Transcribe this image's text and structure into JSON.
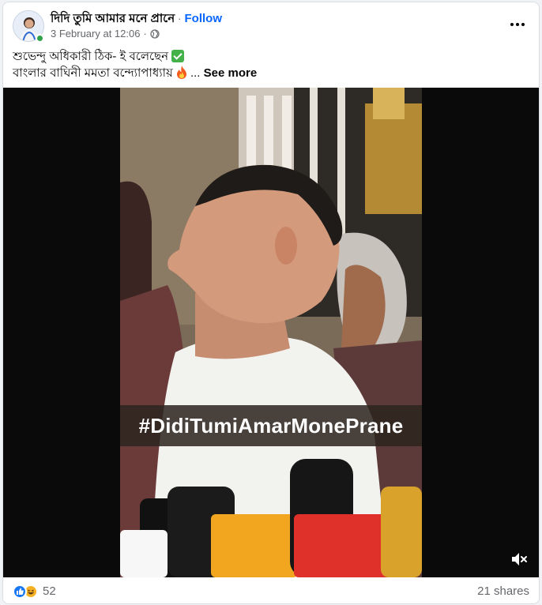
{
  "post": {
    "page_name": "দিদি তুমি আমার মনে প্রানে",
    "separator": "·",
    "follow_label": "Follow",
    "timestamp": "3 February at 12:06",
    "timestamp_separator": "·",
    "audience_icon": "globe-icon",
    "caption_line1": "শুভেন্দু অধিকারী ঠিক- ই বলেছেন",
    "caption_line2": "বাংলার বাঘিনী মমতা বন্দ্যোপাধ্যায়",
    "ellipsis": "...",
    "see_more_label": "See more"
  },
  "video": {
    "hashtag": "#DidiTumiAmarMonePrane",
    "mute_icon": "volume-muted-icon"
  },
  "footer": {
    "reaction_count": "52",
    "reaction_icons": [
      "like-icon",
      "haha-icon"
    ],
    "shares_label": "21 shares"
  },
  "colors": {
    "link": "#0866ff",
    "secondary_text": "#65676b",
    "online": "#31a24c",
    "like": "#1877f2",
    "haha": "#f7b125"
  }
}
